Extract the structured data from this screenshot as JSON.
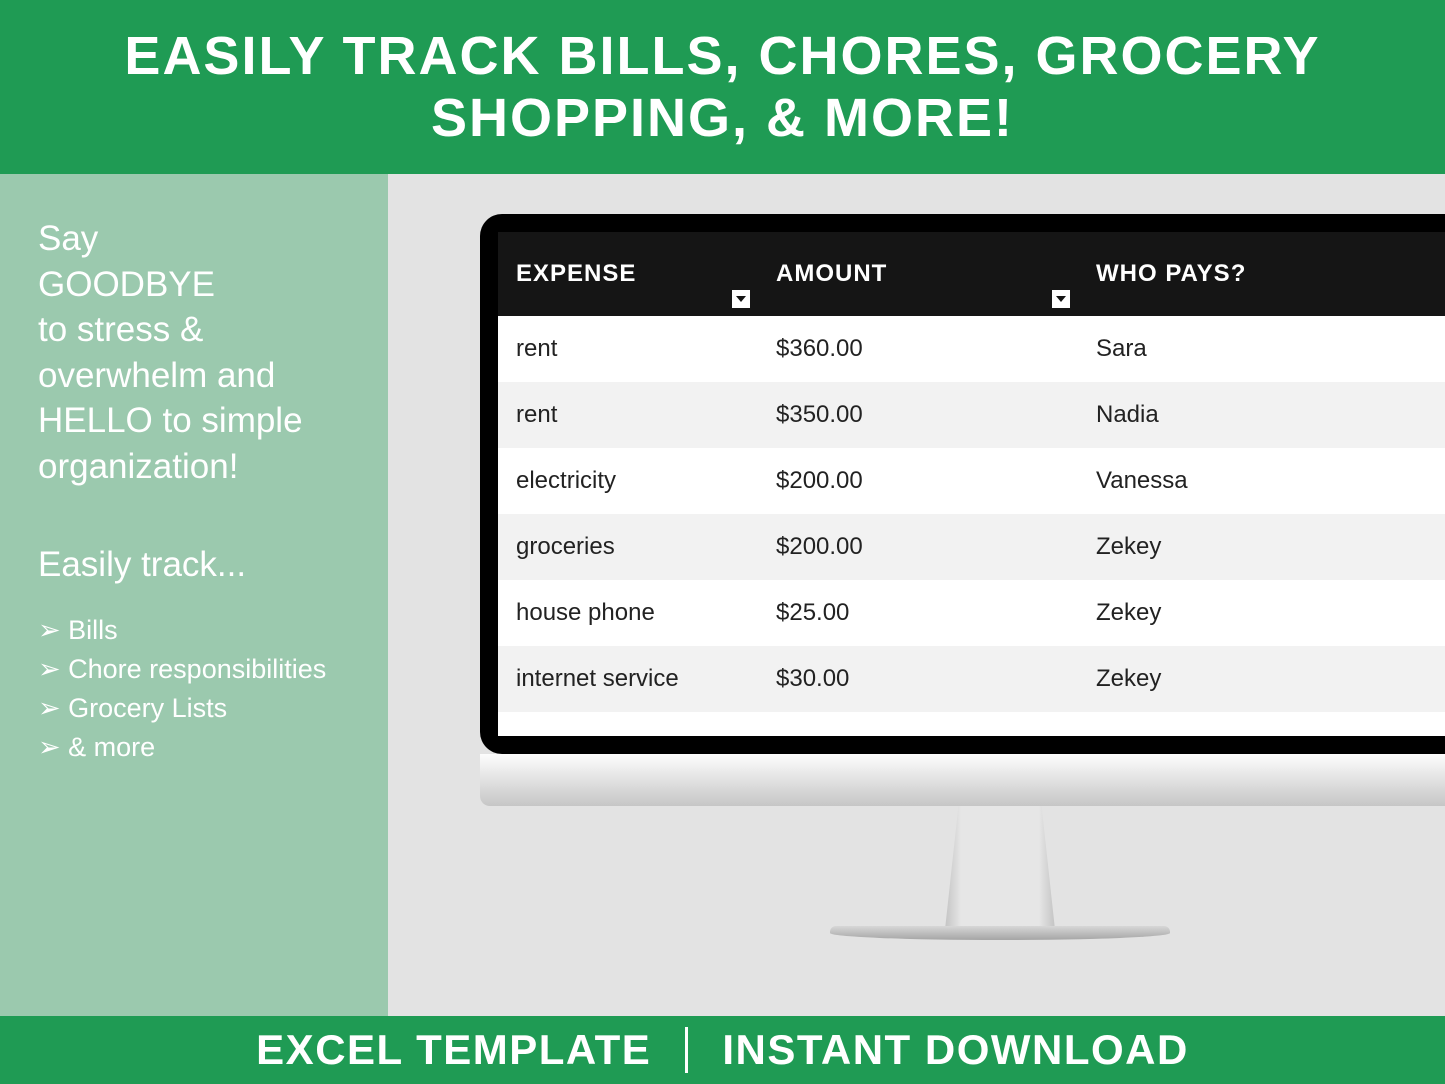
{
  "header": {
    "title": "EASILY TRACK BILLS, CHORES, GROCERY SHOPPING, & MORE!"
  },
  "left": {
    "intro_l1": "Say",
    "intro_l2": "GOODBYE",
    "intro_l3": "to stress & overwhelm and HELLO to simple organization!",
    "subhead": "Easily track...",
    "bullets": [
      "➢ Bills",
      "➢ Chore responsibilities",
      "➢ Grocery Lists",
      "➢ & more"
    ]
  },
  "table": {
    "headers": {
      "expense": "EXPENSE",
      "amount": "AMOUNT",
      "who": "WHO PAYS?"
    },
    "rows": [
      {
        "expense": "rent",
        "amount": "$360.00",
        "who": "Sara"
      },
      {
        "expense": "rent",
        "amount": "$350.00",
        "who": "Nadia"
      },
      {
        "expense": "electricity",
        "amount": "$200.00",
        "who": "Vanessa"
      },
      {
        "expense": "groceries",
        "amount": "$200.00",
        "who": "Zekey"
      },
      {
        "expense": "house phone",
        "amount": "$25.00",
        "who": "Zekey"
      },
      {
        "expense": "internet service",
        "amount": "$30.00",
        "who": "Zekey"
      }
    ]
  },
  "footer": {
    "left": "EXCEL TEMPLATE",
    "right": "INSTANT DOWNLOAD"
  }
}
